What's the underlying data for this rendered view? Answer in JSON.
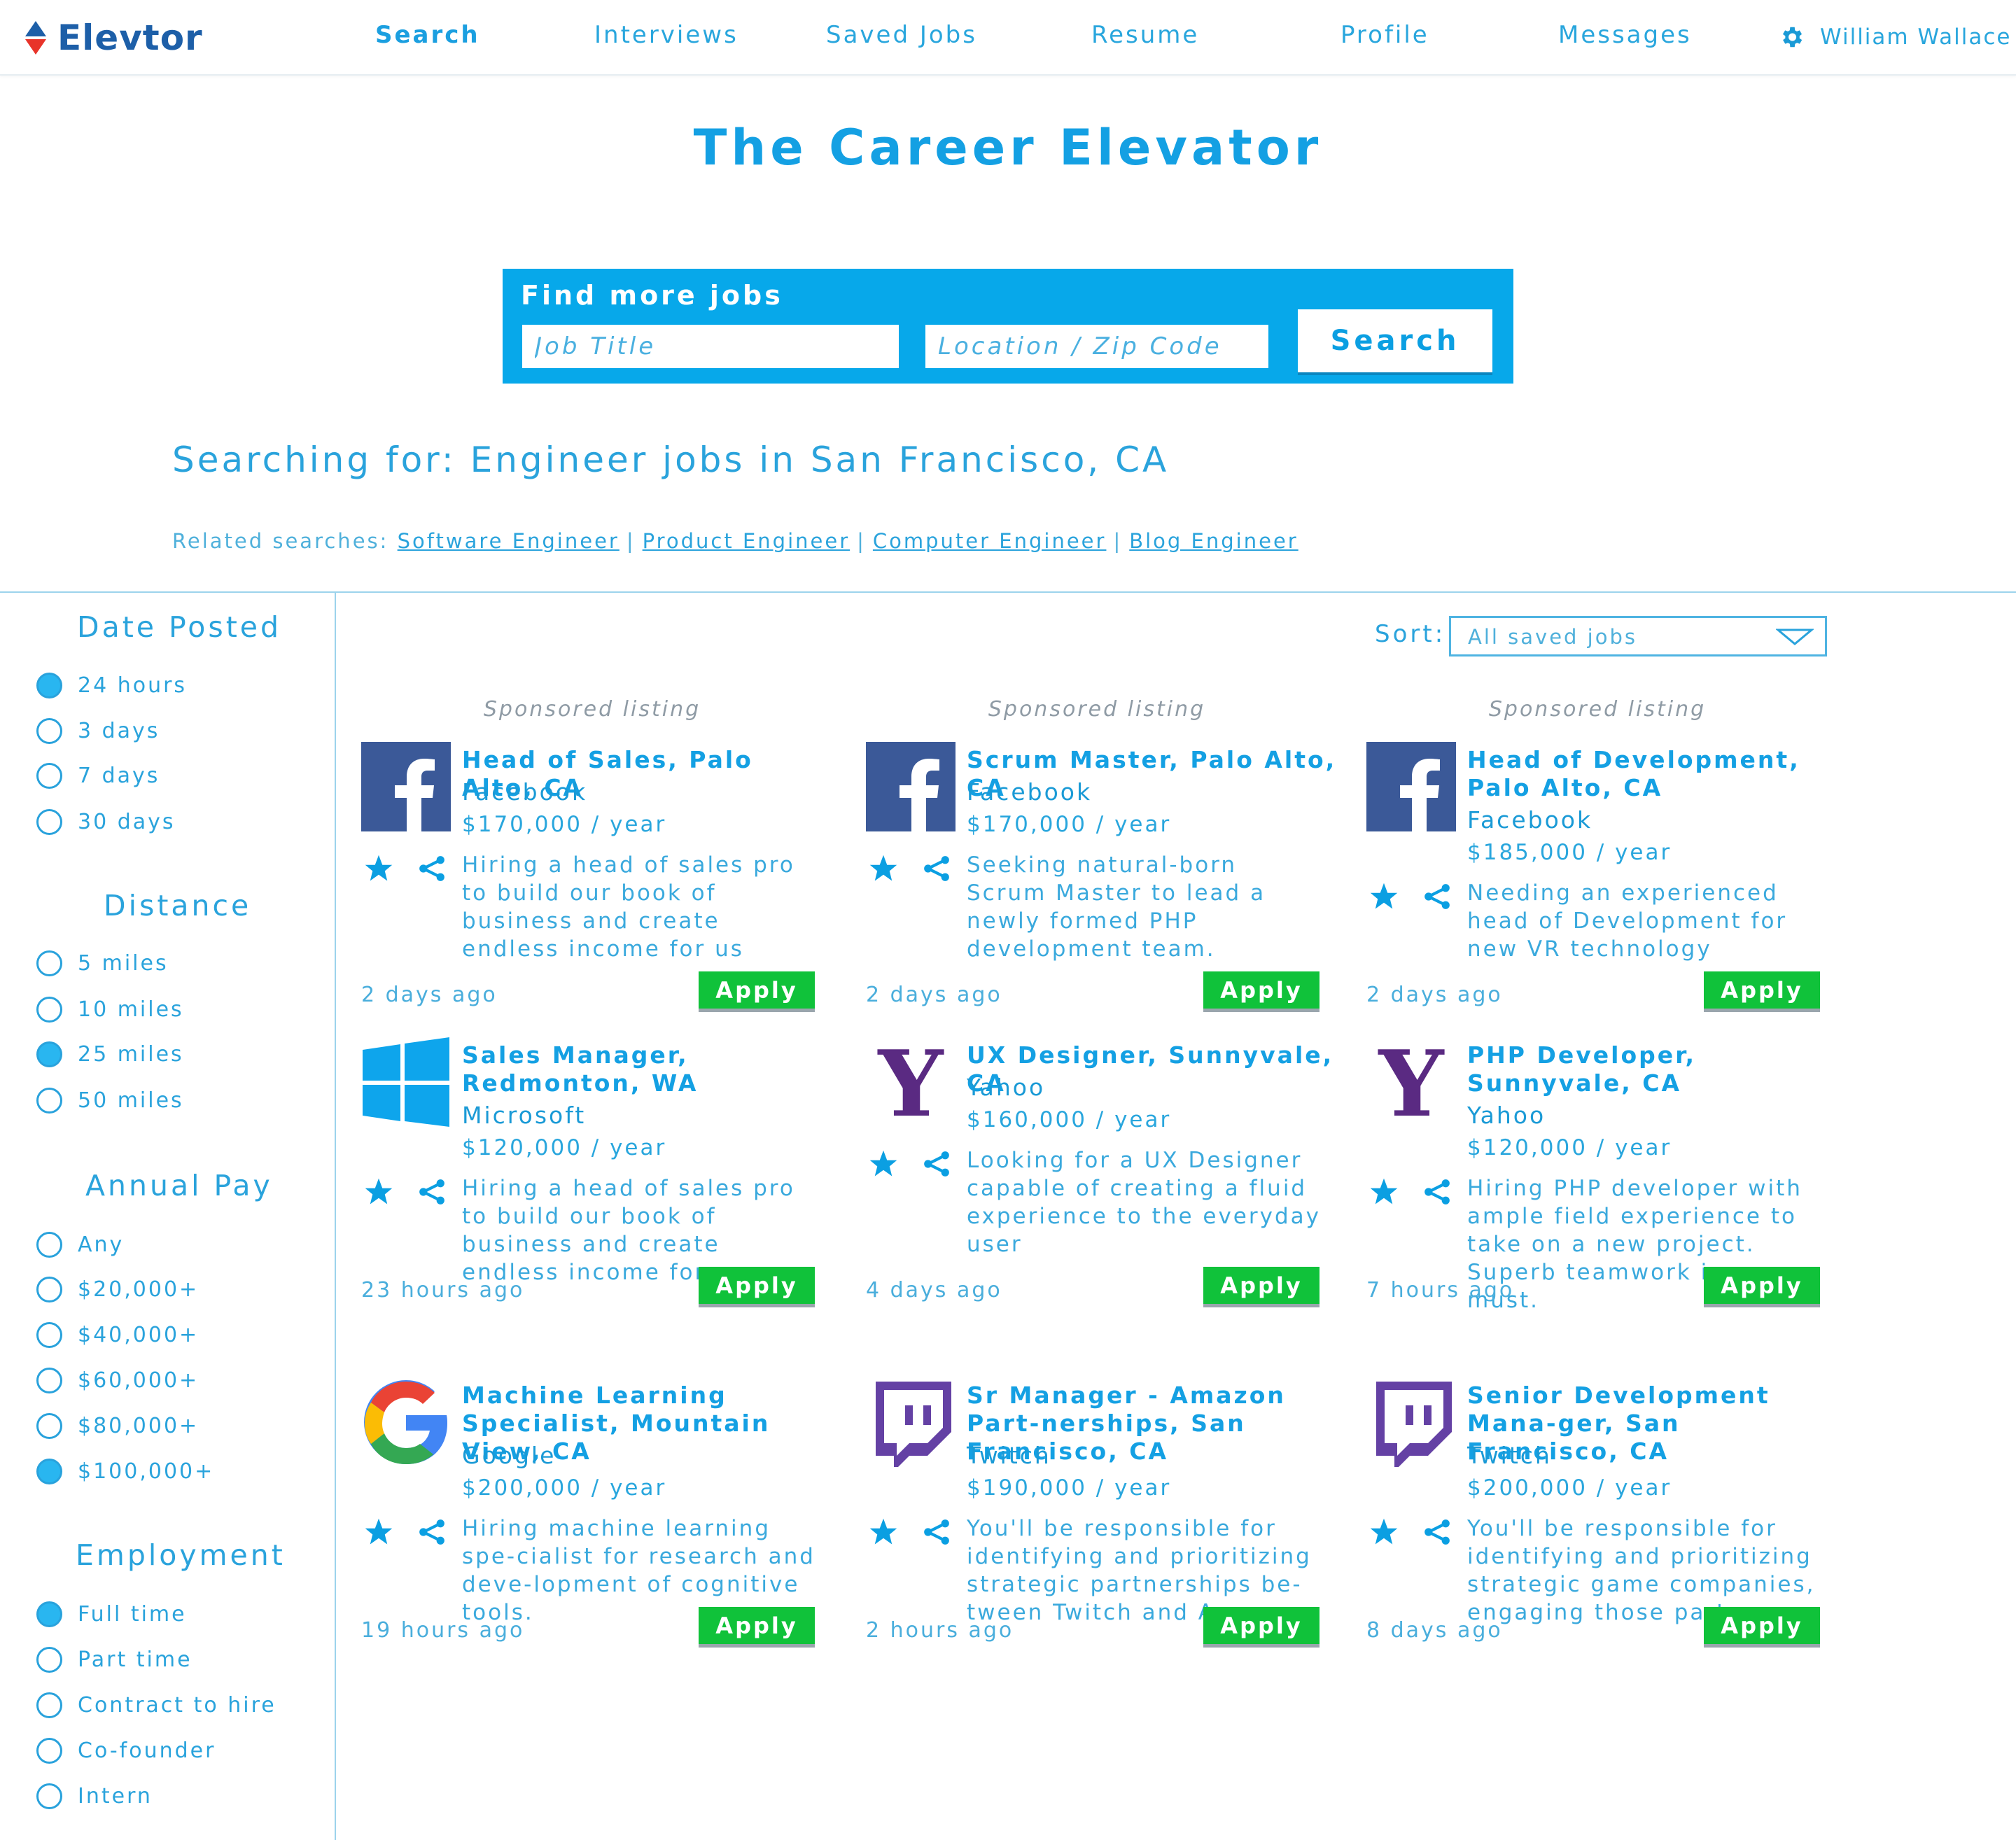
{
  "brand": {
    "name": "Elevtor"
  },
  "nav": {
    "items": [
      "Search",
      "Interviews",
      "Saved Jobs",
      "Resume",
      "Profile",
      "Messages"
    ],
    "active": "Search",
    "user_name": "William Wallace"
  },
  "hero": {
    "title": "The Career Elevator",
    "search_heading": "Find more jobs",
    "job_title_placeholder": "Job Title",
    "location_placeholder": "Location / Zip Code",
    "search_button": "Search"
  },
  "query": {
    "searching_for": "Searching for: Engineer jobs in San Francisco, CA",
    "related_label": "Related searches:",
    "related": [
      "Software Engineer",
      "Product Engineer",
      "Computer Engineer",
      "Blog Engineer"
    ],
    "separator": "|"
  },
  "filters": [
    {
      "title": "Date Posted",
      "options": [
        {
          "label": "24 hours",
          "selected": true
        },
        {
          "label": "3 days",
          "selected": false
        },
        {
          "label": "7 days",
          "selected": false
        },
        {
          "label": "30 days",
          "selected": false
        }
      ]
    },
    {
      "title": "Distance",
      "options": [
        {
          "label": "5 miles",
          "selected": false
        },
        {
          "label": "10 miles",
          "selected": false
        },
        {
          "label": "25 miles",
          "selected": true
        },
        {
          "label": "50 miles",
          "selected": false
        }
      ]
    },
    {
      "title": "Annual Pay",
      "options": [
        {
          "label": "Any",
          "selected": false
        },
        {
          "label": "$20,000+",
          "selected": false
        },
        {
          "label": "$40,000+",
          "selected": false
        },
        {
          "label": "$60,000+",
          "selected": false
        },
        {
          "label": "$80,000+",
          "selected": false
        },
        {
          "label": "$100,000+",
          "selected": true
        }
      ]
    },
    {
      "title": "Employment",
      "options": [
        {
          "label": "Full time",
          "selected": true
        },
        {
          "label": "Part time",
          "selected": false
        },
        {
          "label": "Contract to hire",
          "selected": false
        },
        {
          "label": "Co-founder",
          "selected": false
        },
        {
          "label": "Intern",
          "selected": false
        }
      ]
    }
  ],
  "sort": {
    "label": "Sort:",
    "value": "All saved jobs"
  },
  "jobs": [
    {
      "sponsored_text": "Sponsored listing",
      "logo": "facebook-logo",
      "title": "Head of Sales, Palo Alto, CA",
      "company": "Facebook",
      "salary": "$170,000 / year",
      "description": "Hiring a head of sales pro to build our book of business and create endless income for us",
      "posted": "2 days ago",
      "apply": "Apply"
    },
    {
      "sponsored_text": "Sponsored listing",
      "logo": "facebook-logo",
      "title": "Scrum Master, Palo Alto, CA",
      "company": "Facebook",
      "salary": "$170,000 / year",
      "description": "Seeking natural-born Scrum Master to lead a newly formed PHP development team.",
      "posted": "2 days ago",
      "apply": "Apply"
    },
    {
      "sponsored_text": "Sponsored listing",
      "logo": "facebook-logo",
      "title": "Head of Development, Palo Alto, CA",
      "company": "Facebook",
      "salary": "$185,000 / year",
      "description": "Needing an experienced head of Development for new VR technology",
      "posted": "2 days ago",
      "apply": "Apply"
    },
    {
      "sponsored_text": "",
      "logo": "windows-logo",
      "title": "Sales Manager, Redmonton, WA",
      "company": "Microsoft",
      "salary": "$120,000 / year",
      "description": "Hiring a head of sales pro to build our book of business and create endless income for us",
      "posted": "23 hours ago",
      "apply": "Apply"
    },
    {
      "sponsored_text": "",
      "logo": "yahoo-logo",
      "title": "UX Designer, Sunnyvale, CA",
      "company": "Yahoo",
      "salary": "$160,000 / year",
      "description": "Looking for a UX Designer capable of creating a fluid experience to the everyday user",
      "posted": "4 days ago",
      "apply": "Apply"
    },
    {
      "sponsored_text": "",
      "logo": "yahoo-logo",
      "title": "PHP Developer, Sunnyvale, CA",
      "company": "Yahoo",
      "salary": "$120,000 / year",
      "description": "Hiring PHP developer with ample field experience to take on a new project. Superb teamwork is a must.",
      "posted": "7 hours ago",
      "apply": "Apply"
    },
    {
      "sponsored_text": "",
      "logo": "google-logo",
      "title": "Machine Learning Specialist, Mountain View, CA",
      "company": "Google",
      "salary": "$200,000 / year",
      "description": "Hiring machine learning spe-cialist for research and deve-lopment of cognitive tools.",
      "posted": "19 hours ago",
      "apply": "Apply"
    },
    {
      "sponsored_text": "",
      "logo": "twitch-logo",
      "title": "Sr Manager - Amazon Part-nerships, San Francisco, CA",
      "company": "Twitch",
      "salary": "$190,000 / year",
      "description": "You'll be responsible for identifying and prioritizing strategic partnerships be-tween Twitch and Amazon.",
      "posted": "2 hours ago",
      "apply": "Apply"
    },
    {
      "sponsored_text": "",
      "logo": "twitch-logo",
      "title": "Senior Development Mana-ger, San Francisco, CA",
      "company": "Twitch",
      "salary": "$200,000 / year",
      "description": "You'll be responsible for identifying and prioritizing strategic game companies, engaging those partners",
      "posted": "8 days ago",
      "apply": "Apply"
    }
  ],
  "colors": {
    "primary": "#1a9ad6",
    "search_box": "#07a8ea",
    "apply_green": "#10c23a",
    "brand_navy": "#1d5fa8"
  }
}
